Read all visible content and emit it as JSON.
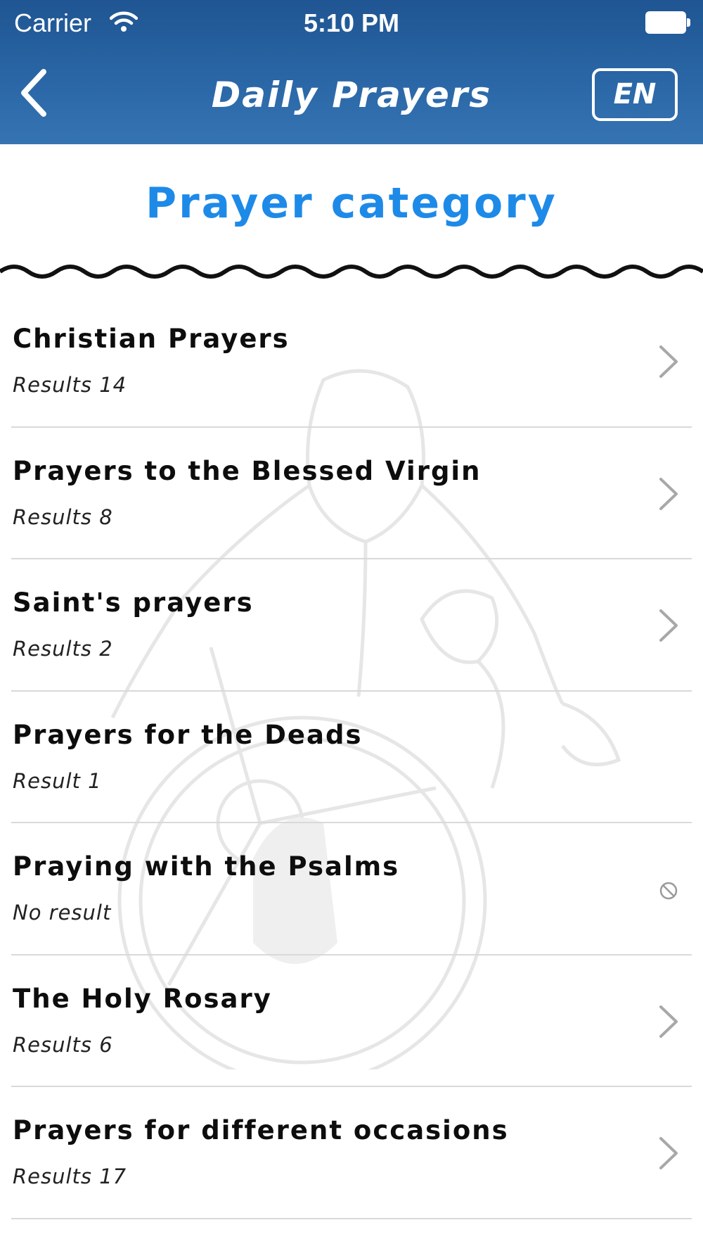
{
  "status_bar": {
    "carrier": "Carrier",
    "time": "5:10 PM"
  },
  "nav": {
    "title": "Daily Prayers",
    "language": "EN"
  },
  "section": {
    "title": "Prayer category"
  },
  "categories": [
    {
      "name": "Christian Prayers",
      "count": "Results 14",
      "icon": "chevron-right-icon"
    },
    {
      "name": "Prayers to the Blessed Virgin",
      "count": "Results 8",
      "icon": "chevron-right-icon"
    },
    {
      "name": "Saint's prayers",
      "count": "Results 2",
      "icon": "chevron-right-icon"
    },
    {
      "name": "Prayers for the Deads",
      "count": "Result 1",
      "icon": "none"
    },
    {
      "name": "Praying with the Psalms",
      "count": "No result",
      "icon": "no-entry-icon"
    },
    {
      "name": "The Holy Rosary",
      "count": "Results 6",
      "icon": "chevron-right-icon"
    },
    {
      "name": "Prayers for different occasions",
      "count": "Results 17",
      "icon": "chevron-right-icon"
    }
  ],
  "colors": {
    "nav_bar": "#2a66a6",
    "section_title": "#1e8ae8",
    "divider": "#d9d9d9"
  }
}
